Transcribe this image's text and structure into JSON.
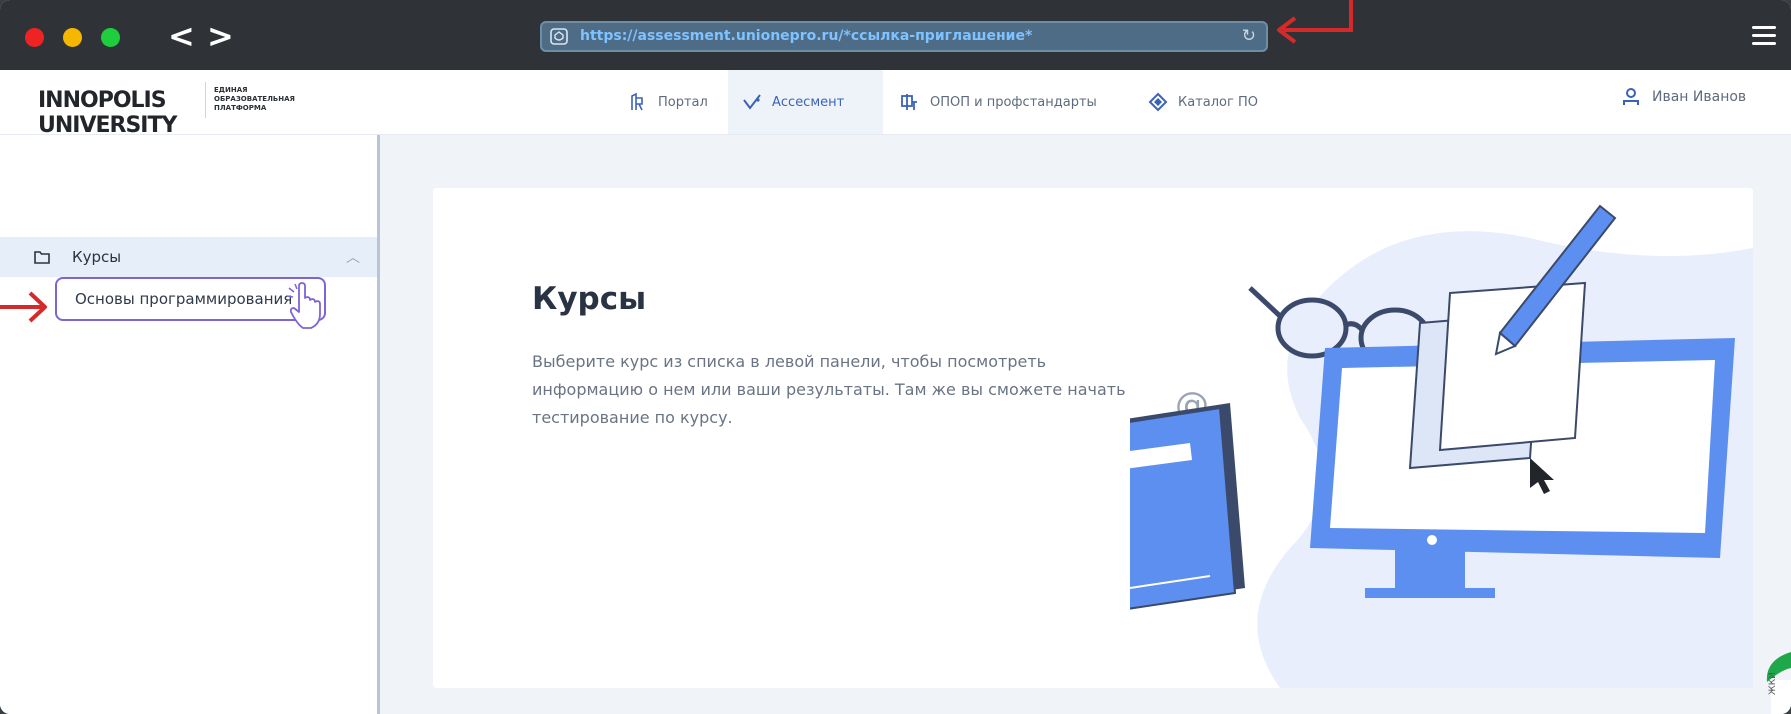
{
  "browser": {
    "url": "https://assessment.unionepro.ru/*ссылка-приглашение*",
    "back_label": "<",
    "forward_label": ">"
  },
  "header": {
    "logo_text": "INNOPOLIS UNIVERSITY",
    "logo_subtitle": "ЕДИНАЯ\nОБРАЗОВАТЕЛЬНАЯ\nПЛАТФОРМА",
    "nav": [
      {
        "label": "Портал",
        "icon": "portal-icon",
        "active": false
      },
      {
        "label": "Ассесмент",
        "icon": "assessment-check-icon",
        "active": true
      },
      {
        "label": "ОПОП и профстандарты",
        "icon": "standards-icon",
        "active": false
      },
      {
        "label": "Каталог ПО",
        "icon": "catalog-diamond-icon",
        "active": false
      }
    ],
    "user_name": "Иван Иванов"
  },
  "sidebar": {
    "section_label": "Курсы",
    "items": [
      {
        "label": "Основы программирования"
      }
    ]
  },
  "main": {
    "title": "Курсы",
    "description": "Выберите курс из списка в левой панели, чтобы посмотреть информацию о нем или ваши результаты. Там же вы сможете начать тестирование по курсу.",
    "at_sign": "@"
  },
  "edge_text": "ЖКИ",
  "colors": {
    "accent": "#3a63b8",
    "sidebar_active_bg": "#e6eef9",
    "highlight_border": "#7d65d6",
    "annotation_red": "#d42a2a",
    "illustration_blue": "#5d8ff0"
  }
}
